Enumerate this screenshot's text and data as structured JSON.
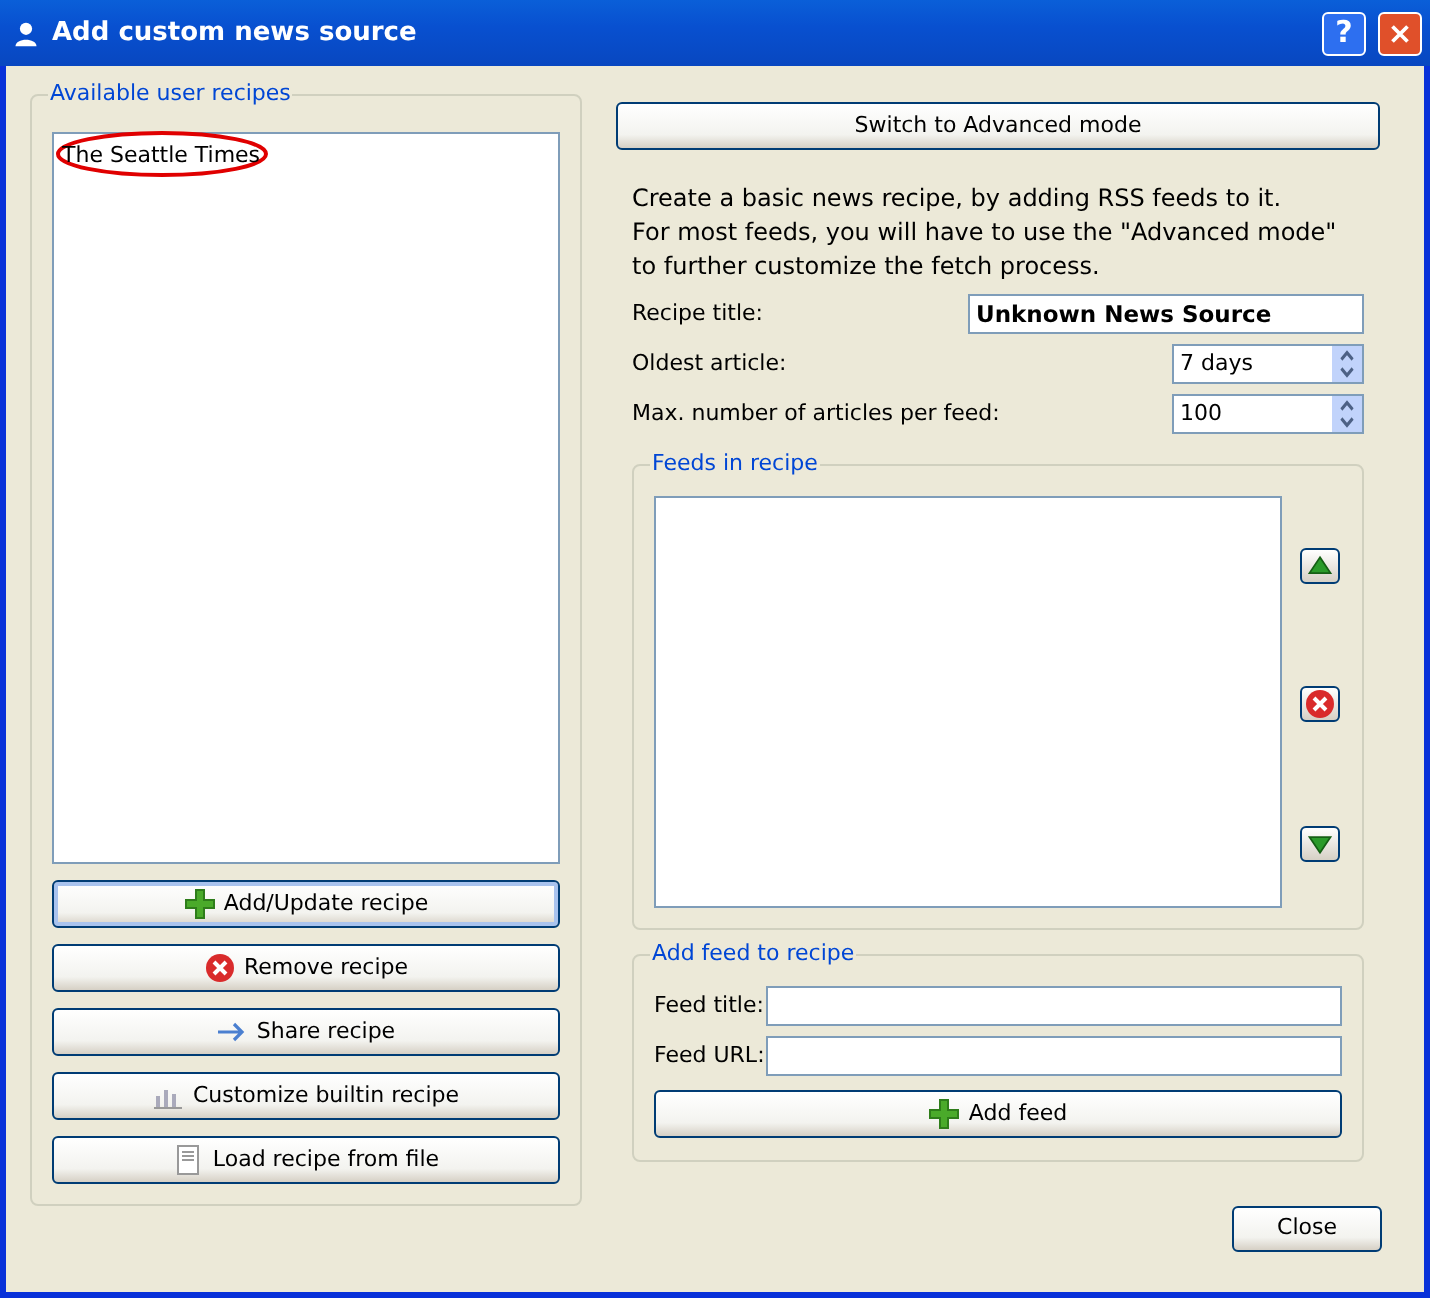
{
  "window": {
    "title": "Add custom news source",
    "help_button": "?"
  },
  "recipes_group": {
    "title": "Available user recipes",
    "items": [
      {
        "label": "The Seattle Times",
        "circled": true
      }
    ]
  },
  "recipe_buttons": [
    {
      "label": "Add/Update recipe",
      "kind": "plus",
      "focused": true
    },
    {
      "label": "Remove recipe",
      "kind": "remove",
      "focused": false
    },
    {
      "label": "Share recipe",
      "kind": "arrow",
      "focused": false
    },
    {
      "label": "Customize builtin recipe",
      "kind": "chart",
      "focused": false
    },
    {
      "label": "Load recipe from file",
      "kind": "document",
      "focused": false
    }
  ],
  "mode_button": "Switch to Advanced mode",
  "intro": "Create a basic news recipe, by adding RSS feeds to it.\nFor most feeds, you will have to use the \"Advanced mode\" to further customize the fetch process.",
  "fields": [
    {
      "kind": "text",
      "label": "Recipe title:",
      "value": "Unknown News Source"
    },
    {
      "kind": "spin",
      "label": "Oldest article:",
      "value": "7 days"
    },
    {
      "kind": "spin",
      "label": "Max. number of articles per feed:",
      "value": "100"
    }
  ],
  "feeds_group": {
    "title": "Feeds in recipe",
    "tools": [
      {
        "kind": "up"
      },
      {
        "kind": "remove"
      },
      {
        "kind": "down"
      }
    ]
  },
  "add_feed_group": {
    "title": "Add feed to recipe",
    "fields": [
      {
        "label": "Feed title:"
      },
      {
        "label": "Feed URL:"
      }
    ],
    "button": "Add feed"
  },
  "close_button": "Close"
}
